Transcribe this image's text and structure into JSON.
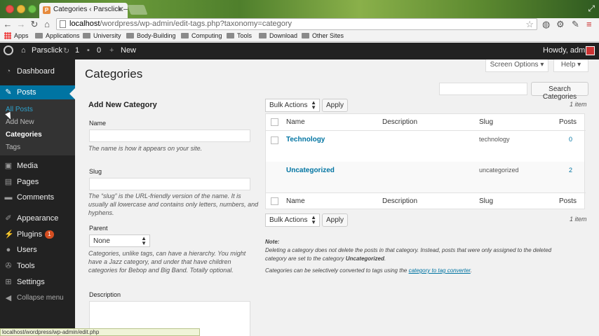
{
  "browser": {
    "tab_title": "Categories ‹ Parsclick — W",
    "url_host": "localhost",
    "url_path": "/wordpress/wp-admin/edit-tags.php?taxonomy=category",
    "status_url": "localhost/wordpress/wp-admin/edit.php",
    "bookmarks": [
      "Apps",
      "Applications",
      "University",
      "Body-Building",
      "Computing",
      "Tools",
      "Download",
      "Other Sites"
    ]
  },
  "adminbar": {
    "site_name": "Parsclick",
    "updates_count": "1",
    "comments_count": "0",
    "new_label": "New",
    "howdy": "Howdy, admin"
  },
  "sidebar": {
    "dashboard": "Dashboard",
    "posts": "Posts",
    "sub": {
      "all_posts": "All Posts",
      "add_new": "Add New",
      "categories": "Categories",
      "tags": "Tags"
    },
    "media": "Media",
    "pages": "Pages",
    "comments": "Comments",
    "appearance": "Appearance",
    "plugins": "Plugins",
    "plugins_badge": "1",
    "users": "Users",
    "tools": "Tools",
    "settings": "Settings",
    "collapse": "Collapse menu"
  },
  "header": {
    "screen_options": "Screen Options ▾",
    "help": "Help ▾",
    "title": "Categories",
    "search_button": "Search Categories"
  },
  "form": {
    "title": "Add New Category",
    "name_label": "Name",
    "name_help": "The name is how it appears on your site.",
    "slug_label": "Slug",
    "slug_help": "The “slug” is the URL-friendly version of the name. It is usually all lowercase and contains only letters, numbers, and hyphens.",
    "parent_label": "Parent",
    "parent_value": "None",
    "parent_help": "Categories, unlike tags, can have a hierarchy. You might have a Jazz category, and under that have children categories for Bebop and Big Band. Totally optional.",
    "description_label": "Description"
  },
  "table": {
    "bulk_actions": "Bulk Actions",
    "apply": "Apply",
    "item_count": "1 item",
    "columns": [
      "Name",
      "Description",
      "Slug",
      "Posts"
    ],
    "rows": [
      {
        "name": "Technology",
        "slug": "technology",
        "count": "0"
      },
      {
        "name": "Uncategorized",
        "slug": "uncategorized",
        "count": "2"
      }
    ]
  },
  "note": {
    "title": "Note:",
    "line1_a": "Deleting a category does not delete the posts in that category. Instead, posts that were only assigned to the deleted category are set to the category ",
    "line1_b": "Uncategorized",
    "line1_c": ".",
    "line2_a": "Categories can be selectively converted to tags using the ",
    "line2_link": "category to tag converter",
    "line2_b": "."
  },
  "colors": {
    "admin_bg": "#222222",
    "accent": "#0074a2",
    "page_bg": "#f1f1f1"
  }
}
